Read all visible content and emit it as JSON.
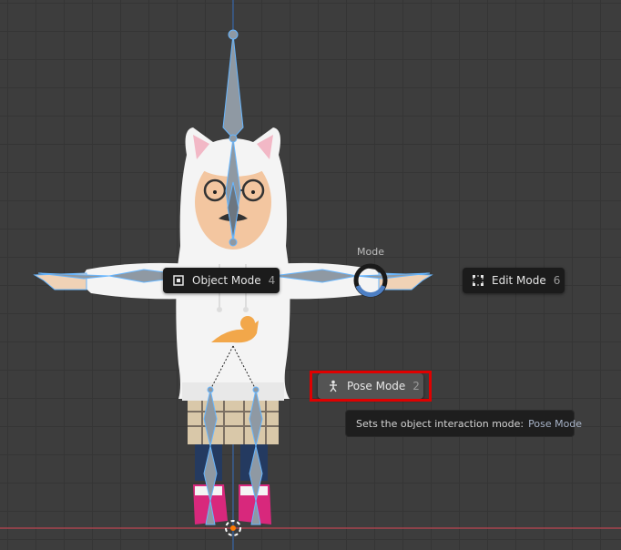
{
  "pie_menu": {
    "title": "Mode",
    "items": [
      {
        "label": "Object Mode",
        "shortcut": "4",
        "icon": "object-mode-icon"
      },
      {
        "label": "Edit Mode",
        "shortcut": "6",
        "icon": "edit-mode-icon"
      },
      {
        "label": "Pose Mode",
        "shortcut": "2",
        "icon": "pose-mode-icon",
        "active": true
      }
    ]
  },
  "tooltip": {
    "text": "Sets the object interaction mode:",
    "value": "Pose Mode"
  },
  "colors": {
    "viewport_bg": "#3d3d3d",
    "grid": "#353535",
    "bone": "#8f99a3",
    "bone_outline": "#67b6ff",
    "highlight": "#e00000",
    "axis_x": "#a8444e",
    "axis_z": "#3c74c2"
  }
}
